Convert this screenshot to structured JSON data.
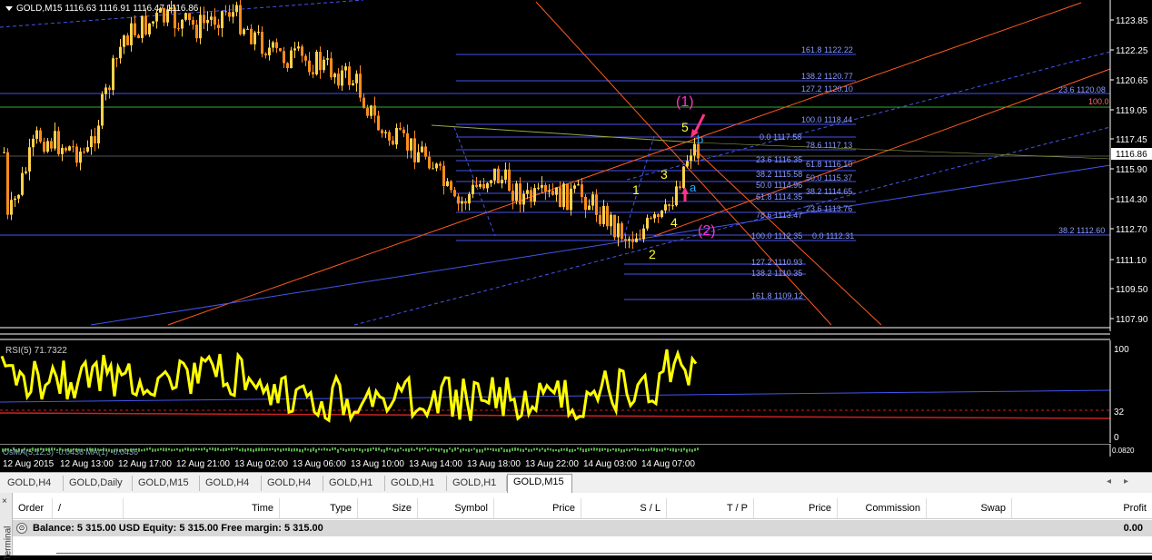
{
  "chart": {
    "ticker": "GOLD,M15",
    "ohlc": "1116.63 1116.91 1116.47 1116.86",
    "current_price": "1116.86",
    "price_axis": [
      "1123.85",
      "1122.25",
      "1120.65",
      "1119.05",
      "1117.45",
      "1115.90",
      "1114.30",
      "1112.70",
      "1111.10",
      "1109.50",
      "1107.90"
    ],
    "fib_labels": [
      {
        "text": "161.8 1122.22",
        "color": "#8899ff"
      },
      {
        "text": "138.2 1120.77",
        "color": "#8899ff"
      },
      {
        "text": "127.2 1120.10",
        "color": "#8899ff"
      },
      {
        "text": "100.0 1118.44",
        "color": "#8899ff"
      },
      {
        "text": "0.0 1117.58",
        "color": "#8899ff"
      },
      {
        "text": "78.6 1117.13",
        "color": "#8899ff"
      },
      {
        "text": "23.6 1116.35",
        "color": "#8899ff"
      },
      {
        "text": "61.8 1116.10",
        "color": "#8899ff"
      },
      {
        "text": "38.2 1115.58",
        "color": "#8899ff"
      },
      {
        "text": "50.0 1115.37",
        "color": "#8899ff"
      },
      {
        "text": "50.0 1114.96",
        "color": "#8899ff"
      },
      {
        "text": "38.2 1114.65",
        "color": "#8899ff"
      },
      {
        "text": "61.8 1114.35",
        "color": "#8899ff"
      },
      {
        "text": "23.6 1113.76",
        "color": "#8899ff"
      },
      {
        "text": "78.6 1113.47",
        "color": "#8899ff"
      },
      {
        "text": "100.0 1112.35",
        "color": "#8899ff"
      },
      {
        "text": "0.0 1112.31",
        "color": "#8899ff"
      },
      {
        "text": "127.2 1110.93",
        "color": "#8899ff"
      },
      {
        "text": "138.2 1110.35",
        "color": "#8899ff"
      },
      {
        "text": "161.8 1109.12",
        "color": "#8899ff"
      },
      {
        "text": "23.6 1120.08",
        "color": "#8899ff"
      },
      {
        "text": "100.0",
        "color": "#ff6666"
      },
      {
        "text": "38.2 1112.60",
        "color": "#8899ff"
      }
    ],
    "wave_labels": {
      "w1_major": "(1)",
      "w2_major": "(2)",
      "w1": "1",
      "w2": "2",
      "w3": "3",
      "w4": "4",
      "w5": "5",
      "wa": "a",
      "wb": "b"
    },
    "colors": {
      "bull": "#ffd24a",
      "bear": "#ff8c1a",
      "fib": "#4455ee",
      "channel": "#ff5a1f",
      "wave": "#ffff33",
      "major": "#ff33cc",
      "ab": "#33aaff"
    }
  },
  "rsi": {
    "label": "RSI(5) 71.7322",
    "levels": [
      "100",
      "32",
      "0"
    ]
  },
  "osma": {
    "label": "OsMA(5,12,3) -0.0436   MA(1) -0.0436",
    "right_label": "0.0820"
  },
  "time_axis": [
    "12 Aug 2015",
    "12 Aug 13:00",
    "12 Aug 17:00",
    "12 Aug 21:00",
    "13 Aug 02:00",
    "13 Aug 06:00",
    "13 Aug 10:00",
    "13 Aug 14:00",
    "13 Aug 18:00",
    "13 Aug 22:00",
    "14 Aug 03:00",
    "14 Aug 07:00"
  ],
  "tabs": [
    "GOLD,H4",
    "GOLD,Daily",
    "GOLD,M15",
    "GOLD,H4",
    "GOLD,H4",
    "GOLD,H1",
    "GOLD,H1",
    "GOLD,H1",
    "GOLD,M15"
  ],
  "active_tab": 8,
  "terminal": {
    "side_label": "Terminal",
    "close": "×",
    "columns": [
      "Order",
      "/",
      "Time",
      "Type",
      "Size",
      "Symbol",
      "Price",
      "S / L",
      "T / P",
      "Price",
      "Commission",
      "Swap",
      "Profit"
    ],
    "balance_text": "Balance: 5 315.00 USD  Equity: 5 315.00  Free margin: 5 315.00",
    "profit": "0.00"
  }
}
